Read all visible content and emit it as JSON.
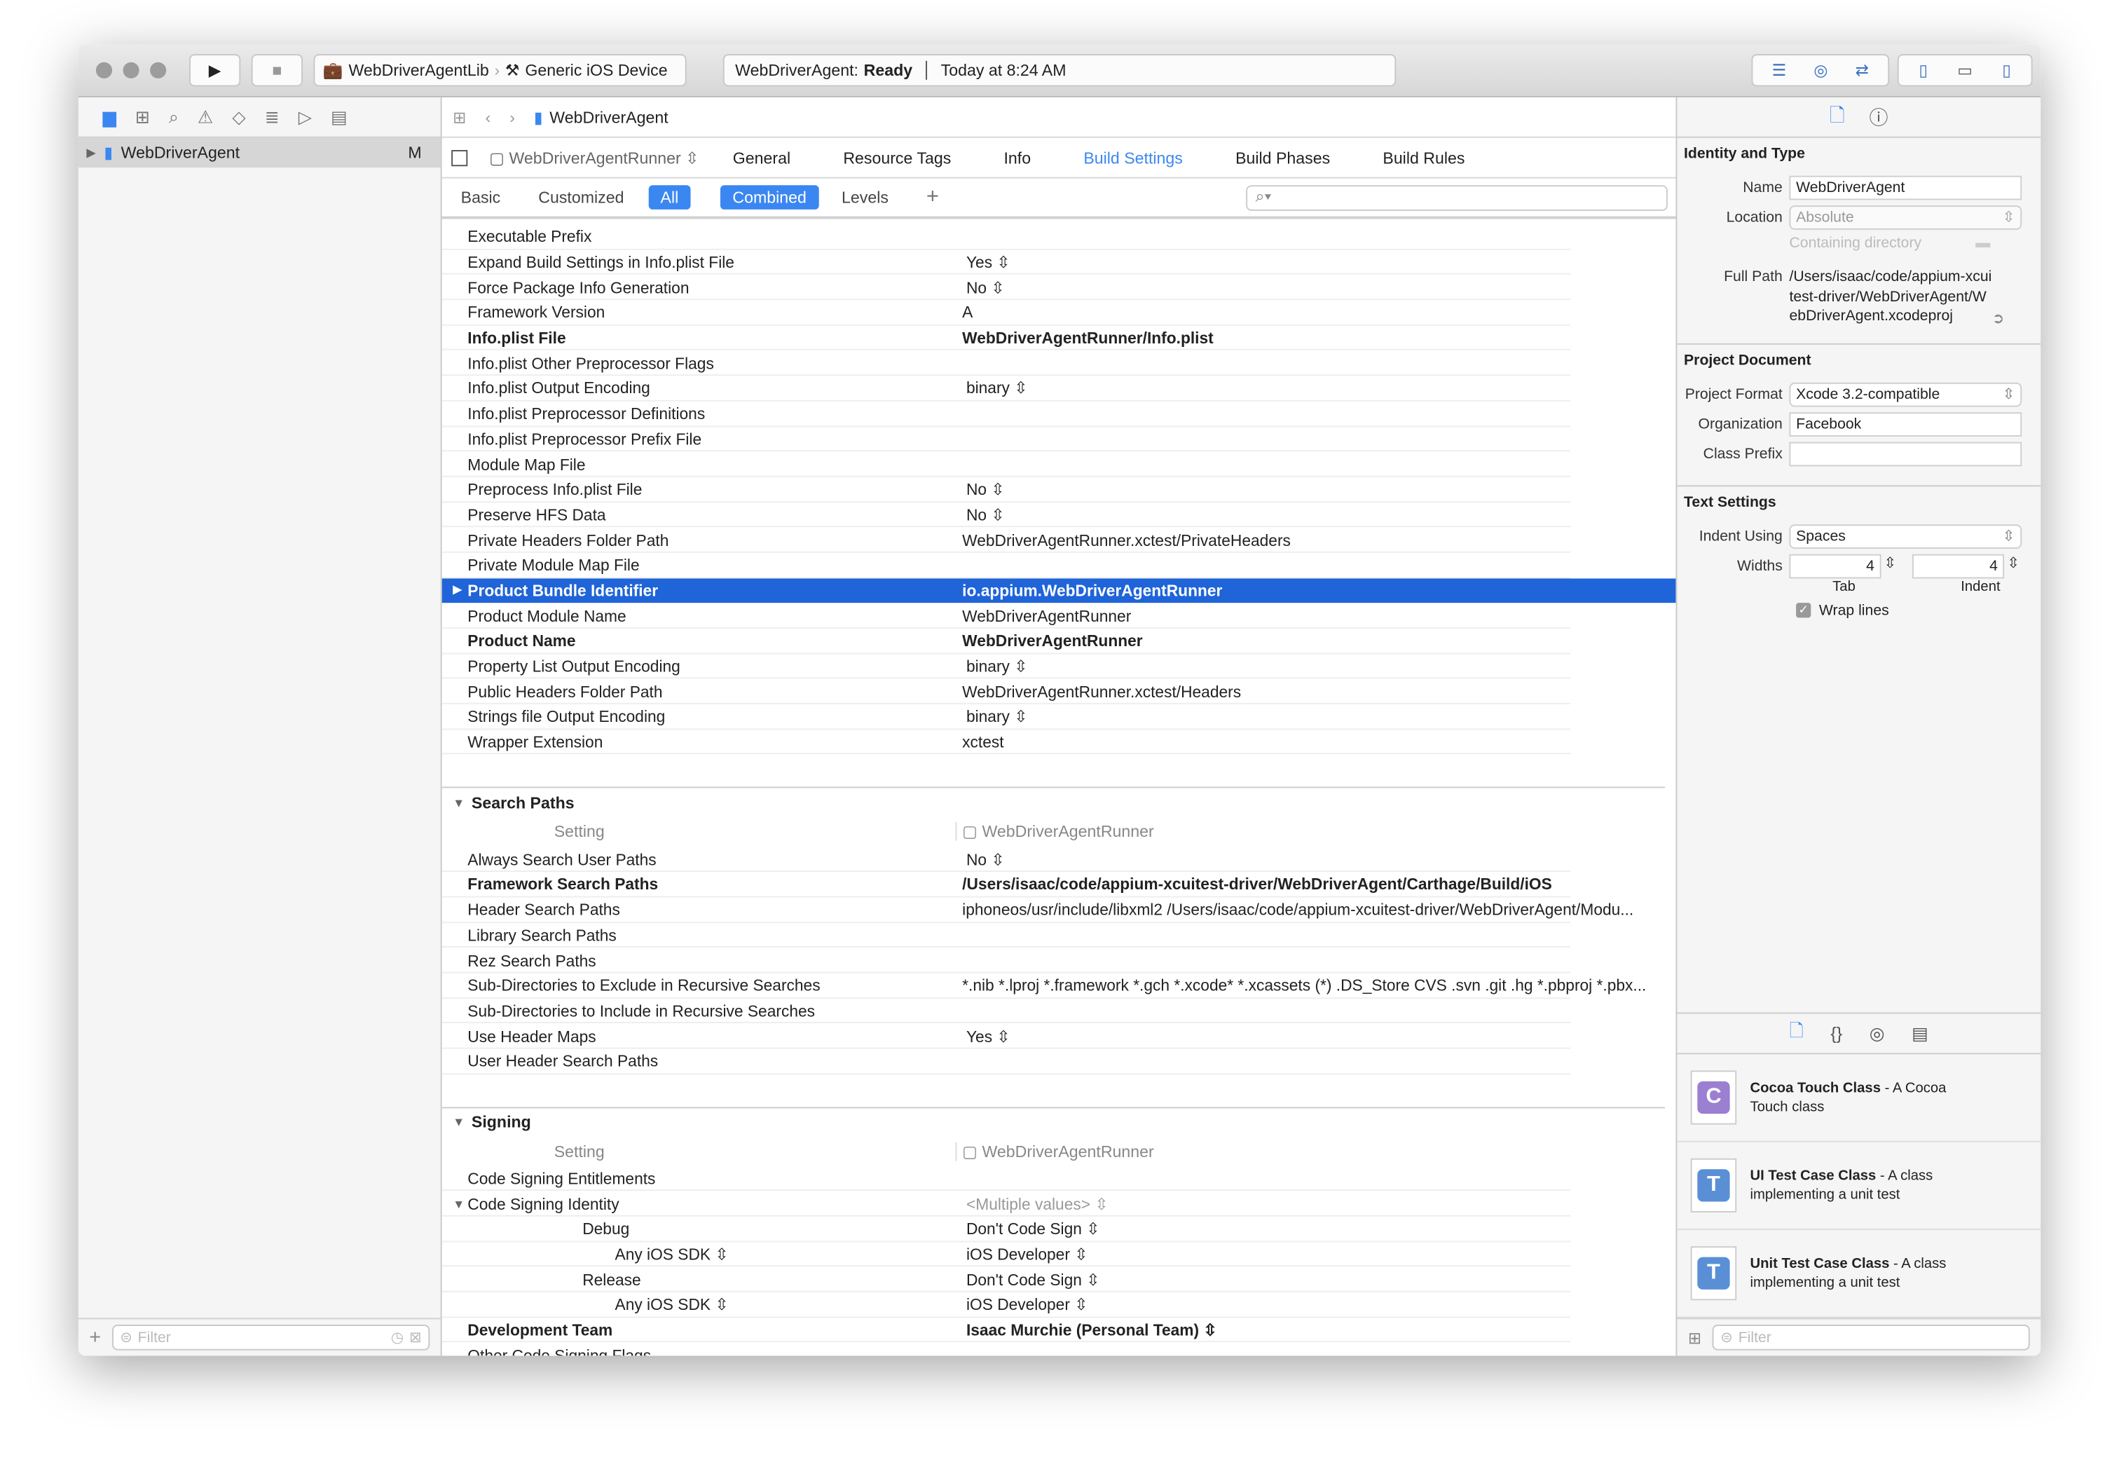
{
  "toolbar": {
    "scheme": "WebDriverAgentLib",
    "device": "Generic iOS Device",
    "status_project": "WebDriverAgent:",
    "status_state": "Ready",
    "status_time": "Today at 8:24 AM"
  },
  "navigator": {
    "item": "WebDriverAgent",
    "badge": "M",
    "filter_placeholder": "Filter"
  },
  "jumpbar": {
    "title": "WebDriverAgent"
  },
  "tabs": {
    "target": "WebDriverAgentRunner",
    "items": [
      "General",
      "Resource Tags",
      "Info",
      "Build Settings",
      "Build Phases",
      "Build Rules"
    ],
    "active": "Build Settings"
  },
  "filterbar": {
    "basic": "Basic",
    "customized": "Customized",
    "all": "All",
    "combined": "Combined",
    "levels": "Levels",
    "add": "+"
  },
  "settings": [
    {
      "n": "Executable Prefix",
      "v": ""
    },
    {
      "n": "Expand Build Settings in Info.plist File",
      "v": "Yes ⇳"
    },
    {
      "n": "Force Package Info Generation",
      "v": "No ⇳"
    },
    {
      "n": "Framework Version",
      "v": "A"
    },
    {
      "n": "Info.plist File",
      "v": "WebDriverAgentRunner/Info.plist",
      "b": true
    },
    {
      "n": "Info.plist Other Preprocessor Flags",
      "v": ""
    },
    {
      "n": "Info.plist Output Encoding",
      "v": "binary ⇳"
    },
    {
      "n": "Info.plist Preprocessor Definitions",
      "v": ""
    },
    {
      "n": "Info.plist Preprocessor Prefix File",
      "v": ""
    },
    {
      "n": "Module Map File",
      "v": ""
    },
    {
      "n": "Preprocess Info.plist File",
      "v": "No ⇳"
    },
    {
      "n": "Preserve HFS Data",
      "v": "No ⇳"
    },
    {
      "n": "Private Headers Folder Path",
      "v": "WebDriverAgentRunner.xctest/PrivateHeaders"
    },
    {
      "n": "Private Module Map File",
      "v": ""
    },
    {
      "n": "Product Bundle Identifier",
      "v": "io.appium.WebDriverAgentRunner",
      "b": true,
      "sel": true
    },
    {
      "n": "Product Module Name",
      "v": "WebDriverAgentRunner"
    },
    {
      "n": "Product Name",
      "v": "WebDriverAgentRunner",
      "b": true
    },
    {
      "n": "Property List Output Encoding",
      "v": "binary ⇳"
    },
    {
      "n": "Public Headers Folder Path",
      "v": "WebDriverAgentRunner.xctest/Headers"
    },
    {
      "n": "Strings file Output Encoding",
      "v": "binary ⇳"
    },
    {
      "n": "Wrapper Extension",
      "v": "xctest"
    }
  ],
  "search_paths": {
    "title": "Search Paths",
    "setting": "Setting",
    "target": "WebDriverAgentRunner",
    "rows": [
      {
        "n": "Always Search User Paths",
        "v": "No ⇳"
      },
      {
        "n": "Framework Search Paths",
        "v": "/Users/isaac/code/appium-xcuitest-driver/WebDriverAgent/Carthage/Build/iOS",
        "b": true
      },
      {
        "n": "Header Search Paths",
        "v": "iphoneos/usr/include/libxml2 /Users/isaac/code/appium-xcuitest-driver/WebDriverAgent/Modu..."
      },
      {
        "n": "Library Search Paths",
        "v": ""
      },
      {
        "n": "Rez Search Paths",
        "v": ""
      },
      {
        "n": "Sub-Directories to Exclude in Recursive Searches",
        "v": "*.nib *.lproj *.framework *.gch *.xcode* *.xcassets (*) .DS_Store CVS .svn .git .hg *.pbproj *.pbx..."
      },
      {
        "n": "Sub-Directories to Include in Recursive Searches",
        "v": ""
      },
      {
        "n": "Use Header Maps",
        "v": "Yes ⇳"
      },
      {
        "n": "User Header Search Paths",
        "v": ""
      }
    ]
  },
  "signing": {
    "title": "Signing",
    "setting": "Setting",
    "target": "WebDriverAgentRunner",
    "rows": [
      {
        "n": "Code Signing Entitlements",
        "v": ""
      },
      {
        "n": "Code Signing Identity",
        "v": "<Multiple values> ⇳",
        "tri": true,
        "grey": true
      },
      {
        "n": "Debug",
        "v": "Don't Code Sign ⇳",
        "ind": 1
      },
      {
        "n": "Any iOS SDK ⇳",
        "v": "iOS Developer ⇳",
        "ind": 2
      },
      {
        "n": "Release",
        "v": "Don't Code Sign ⇳",
        "ind": 1
      },
      {
        "n": "Any iOS SDK ⇳",
        "v": "iOS Developer ⇳",
        "ind": 2
      },
      {
        "n": "Development Team",
        "v": "Isaac Murchie (Personal Team) ⇳",
        "b": true
      },
      {
        "n": "Other Code Signing Flags",
        "v": ""
      }
    ]
  },
  "inspector": {
    "identity": {
      "title": "Identity and Type",
      "name_label": "Name",
      "name": "WebDriverAgent",
      "location_label": "Location",
      "location": "Absolute",
      "containing": "Containing directory",
      "fullpath_label": "Full Path",
      "fullpath": "/Users/isaac/code/appium-xcuitest-driver/WebDriverAgent/WebDriverAgent.xcodeproj"
    },
    "project": {
      "title": "Project Document",
      "format_label": "Project Format",
      "format": "Xcode 3.2-compatible",
      "org_label": "Organization",
      "org": "Facebook",
      "prefix_label": "Class Prefix",
      "prefix": ""
    },
    "text": {
      "title": "Text Settings",
      "indent_label": "Indent Using",
      "indent": "Spaces",
      "widths_label": "Widths",
      "tab": "4",
      "indent_width": "4",
      "tab_label": "Tab",
      "indent_sub": "Indent",
      "wrap": "Wrap lines",
      "wrap_checked": true
    },
    "library": [
      {
        "title": "Cocoa Touch Class",
        "desc": " - A Cocoa Touch class",
        "letter": "C",
        "color": "#9b7fd0"
      },
      {
        "title": "UI Test Case Class",
        "desc": " - A class implementing a unit test",
        "letter": "T",
        "color": "#5a8fd6"
      },
      {
        "title": "Unit Test Case Class",
        "desc": " - A class implementing a unit test",
        "letter": "T",
        "color": "#5a8fd6"
      }
    ],
    "filter_placeholder": "Filter"
  },
  "colors": {
    "accent": "#3b87f1",
    "selection": "#1f64d8"
  }
}
